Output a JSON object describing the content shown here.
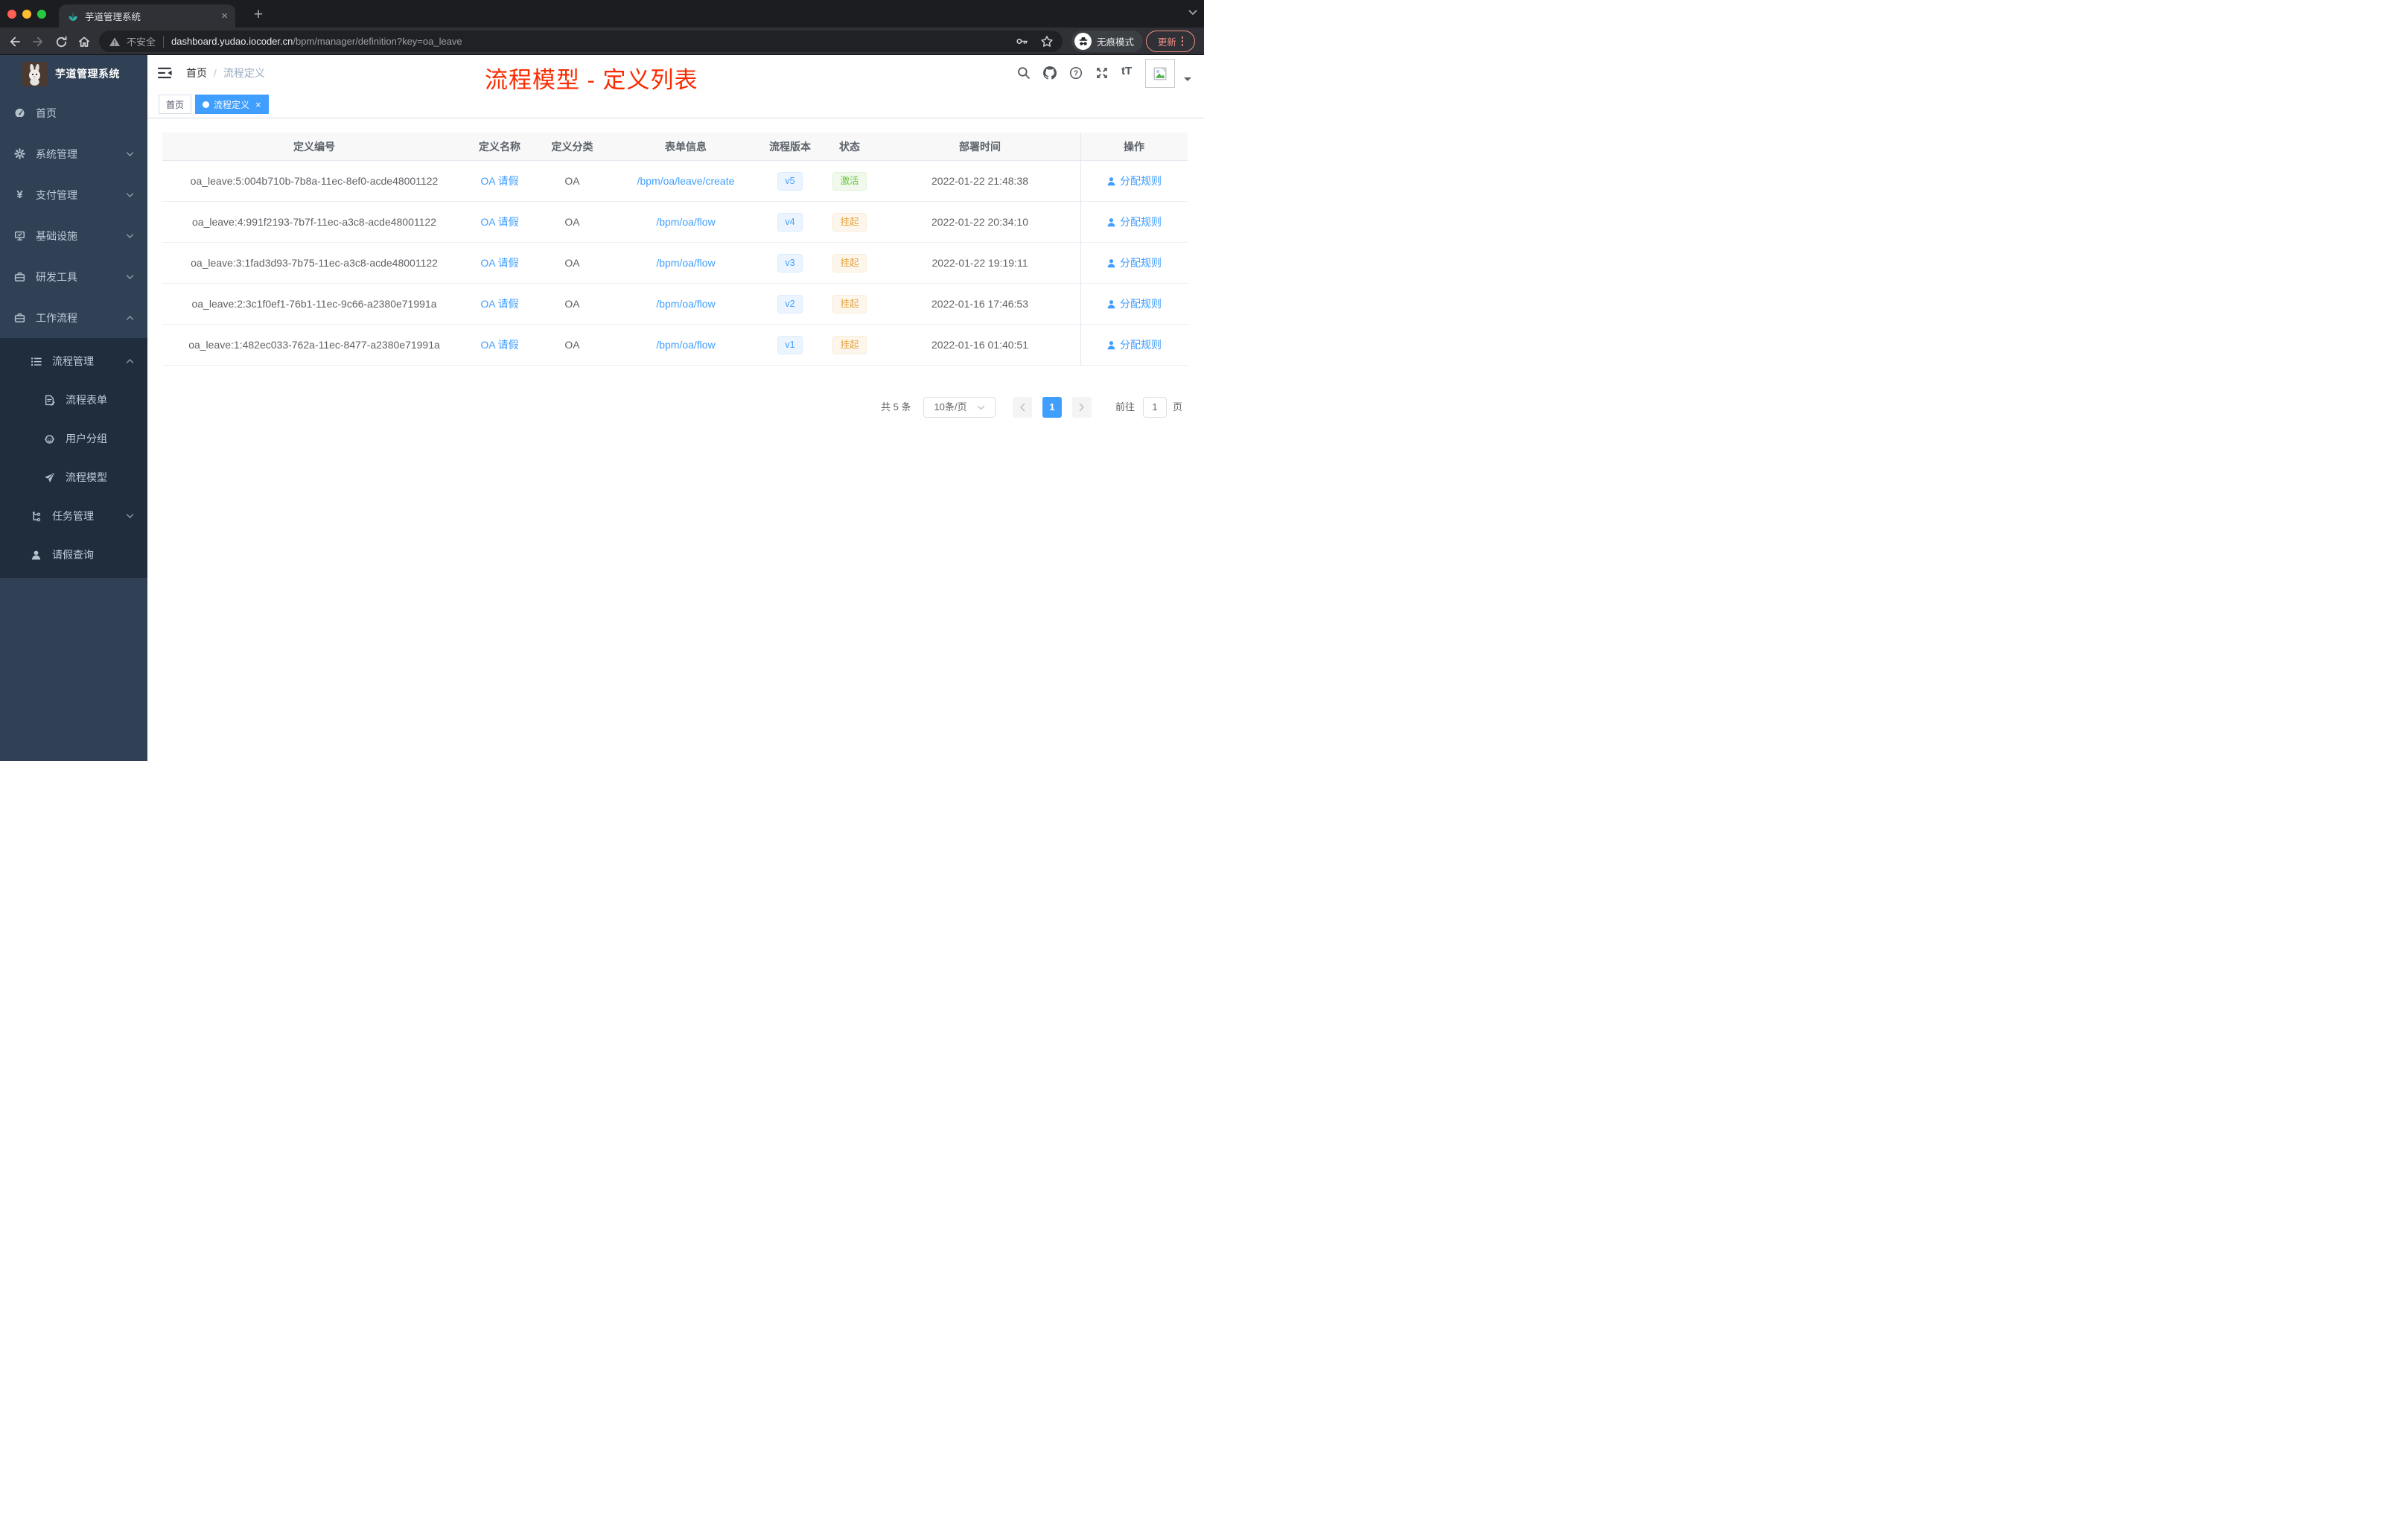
{
  "browser": {
    "tab_title": "芋道管理系统",
    "security_label": "不安全",
    "url_host": "dashboard.yudao.iocoder.cn",
    "url_path": "/bpm/manager/definition?key=oa_leave",
    "incognito_label": "无痕模式",
    "update_label": "更新"
  },
  "sidebar": {
    "app_title": "芋道管理系统",
    "yen_glyph": "¥",
    "menu": [
      {
        "label": "首页"
      },
      {
        "label": "系统管理"
      },
      {
        "label": "支付管理"
      },
      {
        "label": "基础设施"
      },
      {
        "label": "研发工具"
      },
      {
        "label": "工作流程"
      }
    ],
    "submenu": [
      {
        "label": "流程管理"
      },
      {
        "label": "流程表单"
      },
      {
        "label": "用户分组"
      },
      {
        "label": "流程模型"
      },
      {
        "label": "任务管理"
      },
      {
        "label": "请假查询"
      }
    ]
  },
  "header": {
    "breadcrumb_home": "首页",
    "breadcrumb_sep": "/",
    "breadcrumb_current": "流程定义",
    "font_icon_glyph": "tT"
  },
  "annotation": {
    "text": "流程模型 - 定义列表",
    "color": "#f92b00"
  },
  "tags_view": {
    "home": "首页",
    "active": "流程定义"
  },
  "table": {
    "columns": [
      "定义编号",
      "定义名称",
      "定义分类",
      "表单信息",
      "流程版本",
      "状态",
      "部署时间",
      "操作"
    ],
    "rows": [
      {
        "id": "oa_leave:5:004b710b-7b8a-11ec-8ef0-acde48001122",
        "name": "OA 请假",
        "category": "OA",
        "form": "/bpm/oa/leave/create",
        "version": "v5",
        "status": "激活",
        "time": "2022-01-22 21:48:38",
        "action": "分配规则"
      },
      {
        "id": "oa_leave:4:991f2193-7b7f-11ec-a3c8-acde48001122",
        "name": "OA 请假",
        "category": "OA",
        "form": "/bpm/oa/flow",
        "version": "v4",
        "status": "挂起",
        "time": "2022-01-22 20:34:10",
        "action": "分配规则"
      },
      {
        "id": "oa_leave:3:1fad3d93-7b75-11ec-a3c8-acde48001122",
        "name": "OA 请假",
        "category": "OA",
        "form": "/bpm/oa/flow",
        "version": "v3",
        "status": "挂起",
        "time": "2022-01-22 19:19:11",
        "action": "分配规则"
      },
      {
        "id": "oa_leave:2:3c1f0ef1-76b1-11ec-9c66-a2380e71991a",
        "name": "OA 请假",
        "category": "OA",
        "form": "/bpm/oa/flow",
        "version": "v2",
        "status": "挂起",
        "time": "2022-01-16 17:46:53",
        "action": "分配规则"
      },
      {
        "id": "oa_leave:1:482ec033-762a-11ec-8477-a2380e71991a",
        "name": "OA 请假",
        "category": "OA",
        "form": "/bpm/oa/flow",
        "version": "v1",
        "status": "挂起",
        "time": "2022-01-16 01:40:51",
        "action": "分配规则"
      }
    ]
  },
  "pagination": {
    "total": "共 5 条",
    "page_size": "10条/页",
    "page": "1",
    "goto": "前往",
    "goto_value": "1",
    "unit": "页"
  },
  "colors": {
    "primary": "#409eff",
    "status_active": "#67c23a",
    "status_suspended": "#e6a23c",
    "annotation": "#f92b00",
    "sidebar_bg": "#304156",
    "submenu_bg": "#1f2d3d"
  }
}
